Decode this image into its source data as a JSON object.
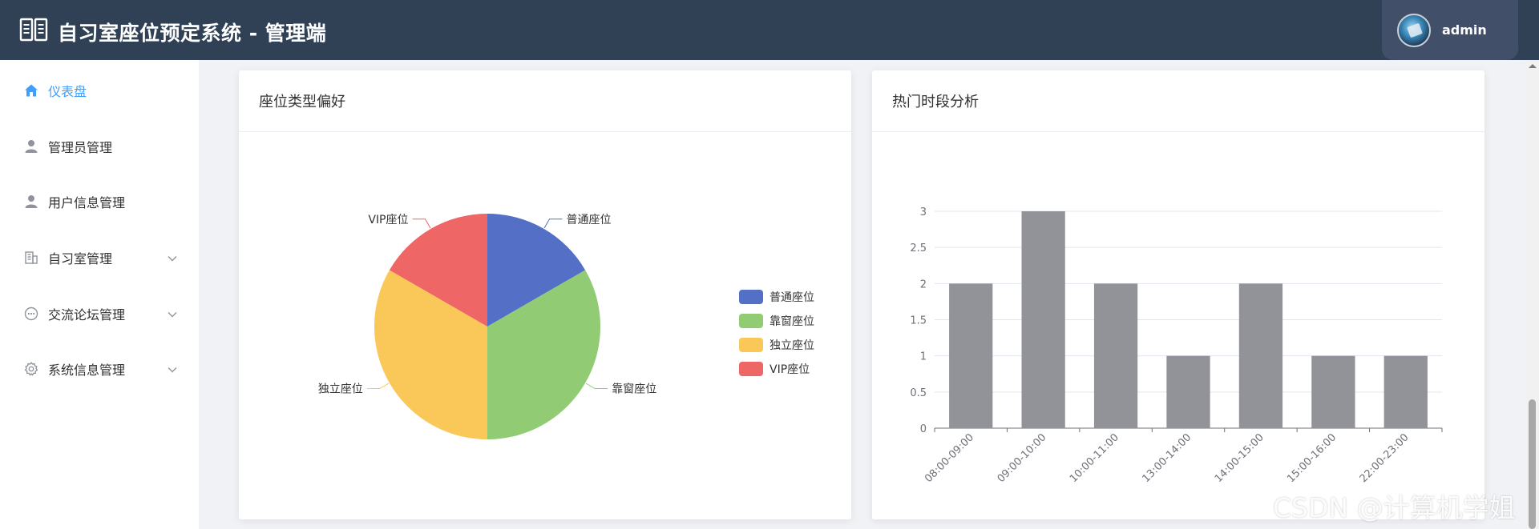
{
  "header": {
    "title": "自习室座位预定系统 - 管理端",
    "logo_icon": "book-open-icon",
    "username": "admin"
  },
  "sidebar": {
    "items": [
      {
        "label": "仪表盘",
        "icon": "home-icon",
        "active": true,
        "expandable": false
      },
      {
        "label": "管理员管理",
        "icon": "user-icon",
        "active": false,
        "expandable": false
      },
      {
        "label": "用户信息管理",
        "icon": "user-icon",
        "active": false,
        "expandable": false
      },
      {
        "label": "自习室管理",
        "icon": "building-icon",
        "active": false,
        "expandable": true
      },
      {
        "label": "交流论坛管理",
        "icon": "chat-icon",
        "active": false,
        "expandable": true
      },
      {
        "label": "系统信息管理",
        "icon": "gear-icon",
        "active": false,
        "expandable": true
      }
    ]
  },
  "colors": {
    "header_bg": "#304156",
    "active": "#409eff",
    "pie": [
      "#5470c6",
      "#91cc75",
      "#fac858",
      "#ee6666"
    ],
    "bar": "#919398"
  },
  "cards": {
    "pie_title": "座位类型偏好",
    "bar_title": "热门时段分析"
  },
  "chart_data": [
    {
      "type": "pie",
      "title": "座位类型偏好",
      "categories": [
        "普通座位",
        "靠窗座位",
        "独立座位",
        "VIP座位"
      ],
      "values": [
        1,
        2,
        2,
        1
      ],
      "legend": "right"
    },
    {
      "type": "bar",
      "title": "热门时段分析",
      "categories": [
        "08:00-09:00",
        "09:00-10:00",
        "10:00-11:00",
        "13:00-14:00",
        "14:00-15:00",
        "15:00-16:00",
        "22:00-23:00"
      ],
      "values": [
        2,
        3,
        2,
        1,
        2,
        1,
        1
      ],
      "ylim": [
        0,
        3
      ],
      "yticks": [
        "0",
        "0.5",
        "1",
        "1.5",
        "2",
        "2.5",
        "3"
      ],
      "grid": true
    }
  ],
  "watermark": "CSDN @计算机学姐"
}
